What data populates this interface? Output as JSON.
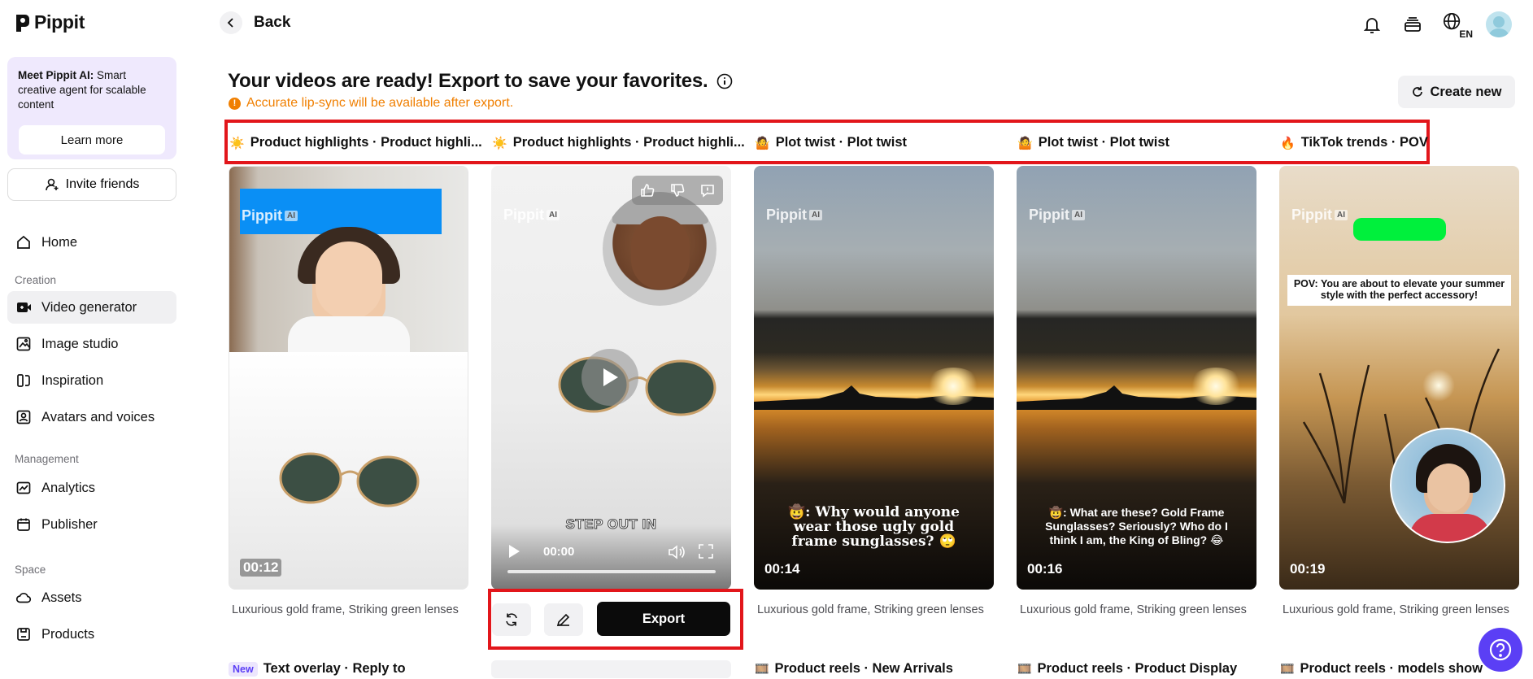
{
  "app": {
    "name": "Pippit"
  },
  "sidebar": {
    "promo": {
      "title": "Meet Pippit AI:",
      "text": "Smart creative agent for scalable content",
      "button": "Learn more"
    },
    "invite": "Invite friends",
    "items": [
      {
        "label": "Home",
        "icon": "home-icon"
      },
      {
        "section": "Creation"
      },
      {
        "label": "Video generator",
        "icon": "video-generator-icon",
        "active": true
      },
      {
        "label": "Image studio",
        "icon": "image-studio-icon"
      },
      {
        "label": "Inspiration",
        "icon": "inspiration-icon"
      },
      {
        "label": "Avatars and voices",
        "icon": "avatar-icon"
      },
      {
        "section": "Management"
      },
      {
        "label": "Analytics",
        "icon": "analytics-icon"
      },
      {
        "label": "Publisher",
        "icon": "calendar-icon"
      },
      {
        "section": "Space"
      },
      {
        "label": "Assets",
        "icon": "cloud-icon"
      },
      {
        "label": "Products",
        "icon": "products-icon"
      }
    ],
    "sections": {
      "creation": "Creation",
      "management": "Management",
      "space": "Space"
    },
    "labels": {
      "home": "Home",
      "video_generator": "Video generator",
      "image_studio": "Image studio",
      "inspiration": "Inspiration",
      "avatars": "Avatars and voices",
      "analytics": "Analytics",
      "publisher": "Publisher",
      "assets": "Assets",
      "products": "Products"
    }
  },
  "header": {
    "back": "Back",
    "language": "EN",
    "icons": [
      "bell-icon",
      "stack-icon",
      "globe-icon",
      "avatar"
    ]
  },
  "main": {
    "headline": "Your videos are ready! Export to save your favorites.",
    "notice": "Accurate lip-sync will be available after export.",
    "create_new": "Create new",
    "tabs": [
      {
        "emoji": "☀️",
        "label": "Product highlights · Product highli..."
      },
      {
        "emoji": "☀️",
        "label": "Product highlights · Product highli..."
      },
      {
        "emoji": "🤷",
        "label": "Plot twist · Plot twist"
      },
      {
        "emoji": "🤷",
        "label": "Plot twist · Plot twist"
      },
      {
        "emoji": "🔥",
        "label": "TikTok trends · POV"
      }
    ],
    "cards": [
      {
        "time": "00:12",
        "caption": "Luxurious gold frame, Striking green lenses"
      },
      {
        "time": "00:00",
        "caption_overlay": "STEP OUT IN",
        "watermark": "Pippit"
      },
      {
        "time": "00:14",
        "caption": "Luxurious gold frame, Striking green lenses",
        "overlay": "🤠: Why would anyone wear those ugly gold frame sunglasses? 🙄"
      },
      {
        "time": "00:16",
        "caption": "Luxurious gold frame, Striking green lenses",
        "overlay": "🤠: What are these? Gold Frame Sunglasses? Seriously? Who do I think I am, the King of Bling? 😂"
      },
      {
        "time": "00:19",
        "caption": "Luxurious gold frame, Striking green lenses",
        "overlay": "POV: You are about to elevate your summer style with the perfect accessory!"
      }
    ],
    "watermark": "Pippit",
    "watermark_ai": "AI",
    "actions": {
      "export": "Export"
    },
    "row2": [
      {
        "badge": "New",
        "label": "Text overlay · Reply to"
      },
      {
        "label": ""
      },
      {
        "emoji": "🎞️",
        "label": "Product reels · New Arrivals"
      },
      {
        "emoji": "🎞️",
        "label": "Product reels · Product Display"
      },
      {
        "emoji": "🎞️",
        "label": "Product reels · models show"
      }
    ]
  },
  "colors": {
    "accent": "#5b3ff5",
    "highlight": "#e2161b",
    "warning": "#f07f00",
    "promo_bg": "#efe9fd"
  }
}
